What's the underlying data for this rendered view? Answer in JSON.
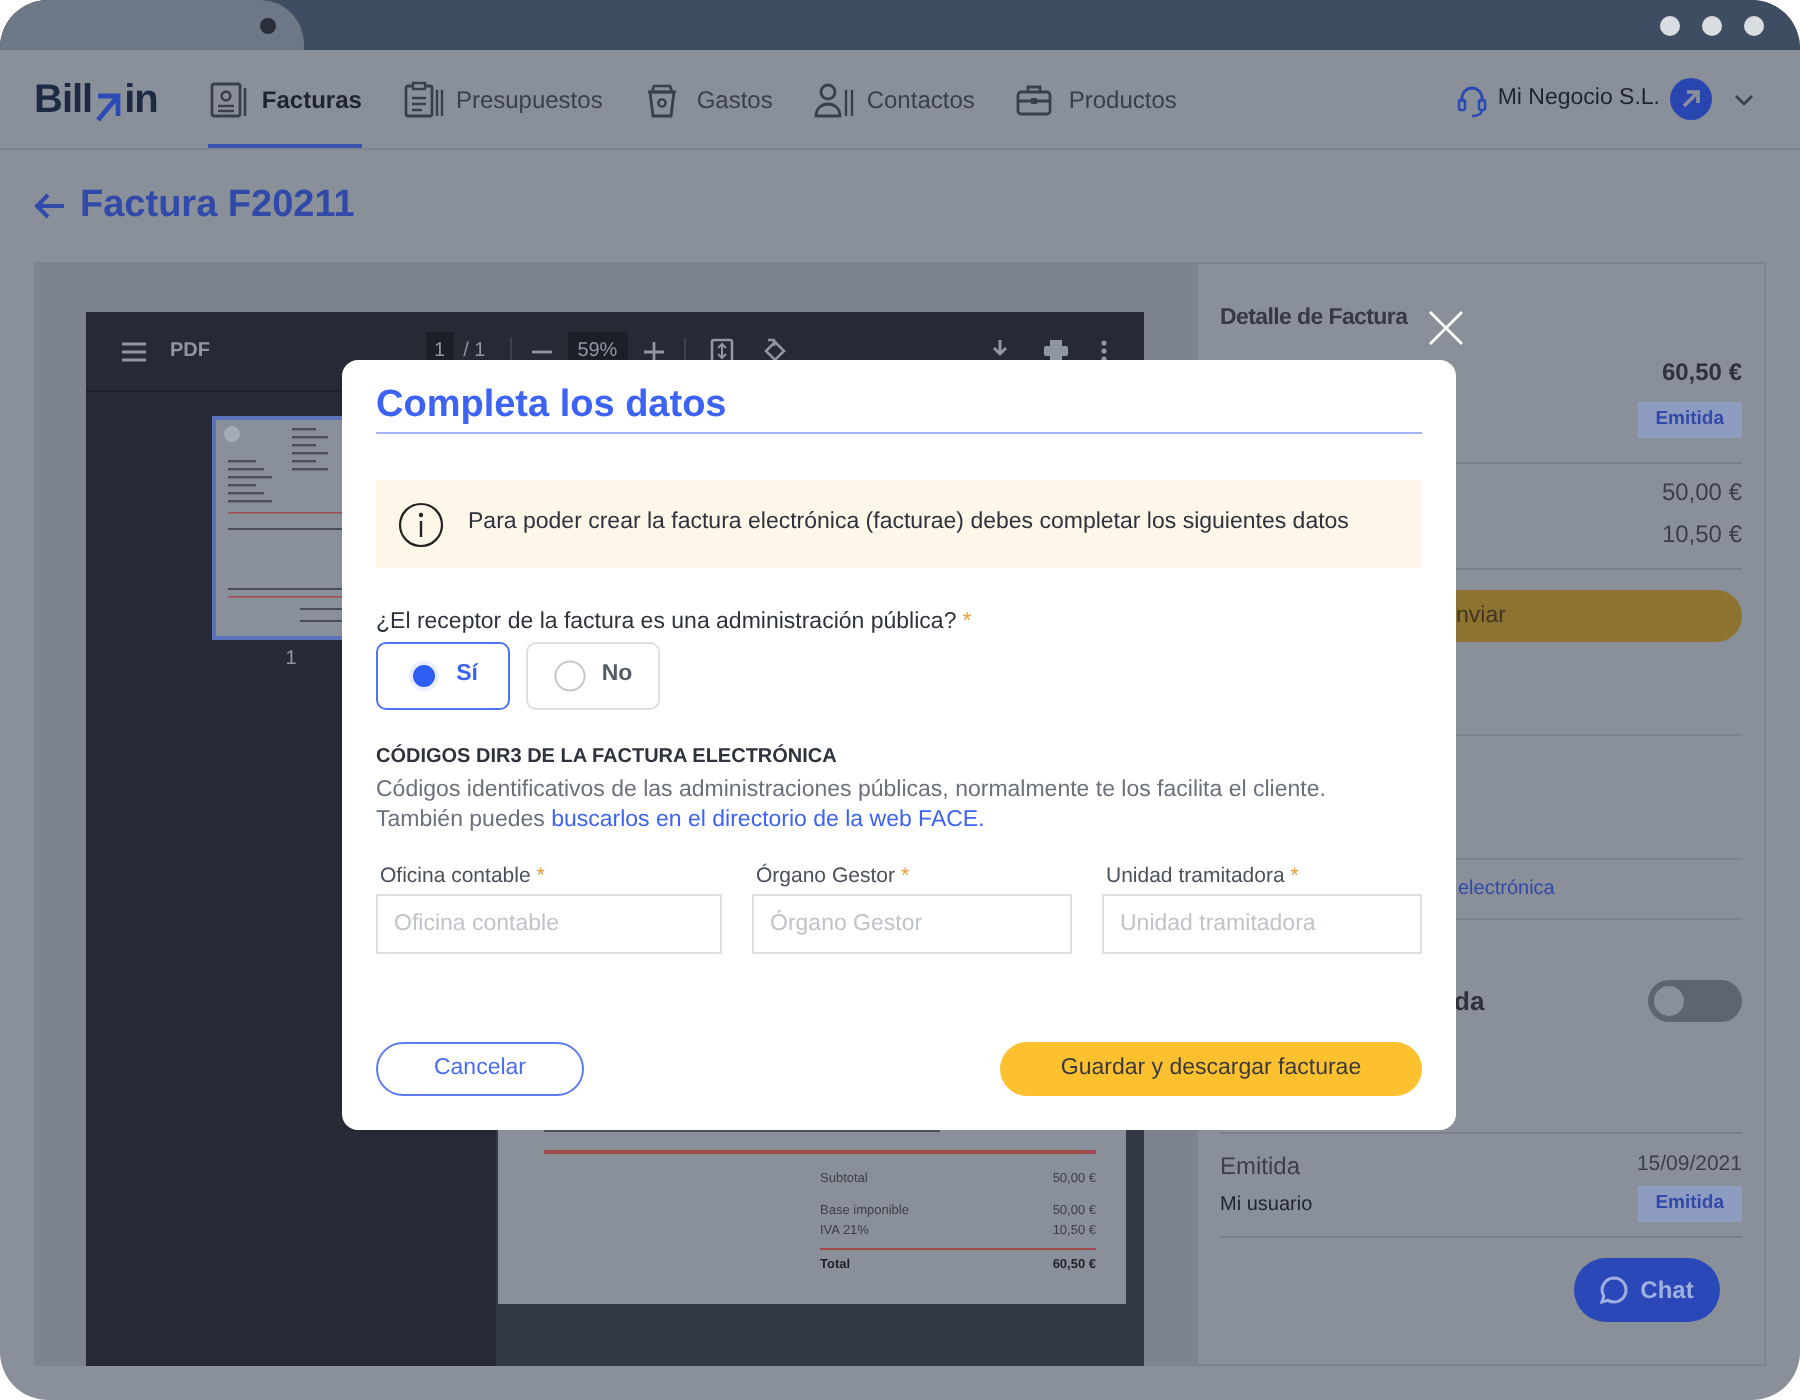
{
  "logo": {
    "text_before": "Bill",
    "text_after": "in"
  },
  "nav": [
    {
      "label": "Facturas",
      "selected": true
    },
    {
      "label": "Presupuestos",
      "selected": false
    },
    {
      "label": "Gastos",
      "selected": false
    },
    {
      "label": "Contactos",
      "selected": false
    },
    {
      "label": "Productos",
      "selected": false
    }
  ],
  "account": {
    "name": "Mi Negocio S.L."
  },
  "page": {
    "title": "Factura F20211"
  },
  "pdf_viewer": {
    "title": "PDF",
    "page": "1",
    "page_total": "/ 1",
    "zoom": "59%",
    "thumbnail_label": "1",
    "rows": [
      {
        "kind": "plain",
        "label": "Subtotal",
        "value": "50,00 €"
      },
      {
        "kind": "plain",
        "label": "Base imponible",
        "value": "50,00 €"
      },
      {
        "kind": "plain",
        "label": "IVA 21%",
        "value": "10,50 €"
      },
      {
        "kind": "total",
        "label": "Total",
        "value": "60,50 €"
      }
    ]
  },
  "detail": {
    "title": "Detalle de Factura",
    "total": "60,50 €",
    "status_badge": "Emitida",
    "base": "50,00 €",
    "tax": "10,50 €",
    "send_button_fragment": "nviar",
    "link_fragment": "electrónica",
    "toggle_label_fragment": "da",
    "toggle": {
      "on": false
    },
    "history": [
      {
        "status": "Emitida",
        "date": "15/09/2021",
        "user": "Mi usuario",
        "badge": "Emitida"
      }
    ]
  },
  "modal": {
    "title": "Completa los datos",
    "notice": "Para poder crear la factura electrónica (facturae) debes completar los siguientes datos",
    "question": "¿El receptor de la factura es una administración pública?",
    "question_required_mark": "*",
    "options": [
      {
        "label": "Sí",
        "selected": true
      },
      {
        "label": "No",
        "selected": false
      }
    ],
    "section_heading": "CÓDIGOS DIR3 DE LA FACTURA ELECTRÓNICA",
    "description": "Códigos identificativos de las administraciones públicas, normalmente te los facilita el cliente.",
    "hint": "También puedes",
    "hint_link": "buscarlos en el directorio de la web FACE.",
    "fields": [
      {
        "label": "Oficina contable",
        "required_mark": "*",
        "placeholder": "Oficina contable"
      },
      {
        "label": "Órgano Gestor",
        "required_mark": "*",
        "placeholder": "Órgano Gestor"
      },
      {
        "label": "Unidad tramitadora",
        "required_mark": "*",
        "placeholder": "Unidad tramitadora"
      }
    ],
    "cancel_button": "Cancelar",
    "submit_button": "Guardar y descargar facturae"
  },
  "chat": {
    "label": "Chat"
  }
}
